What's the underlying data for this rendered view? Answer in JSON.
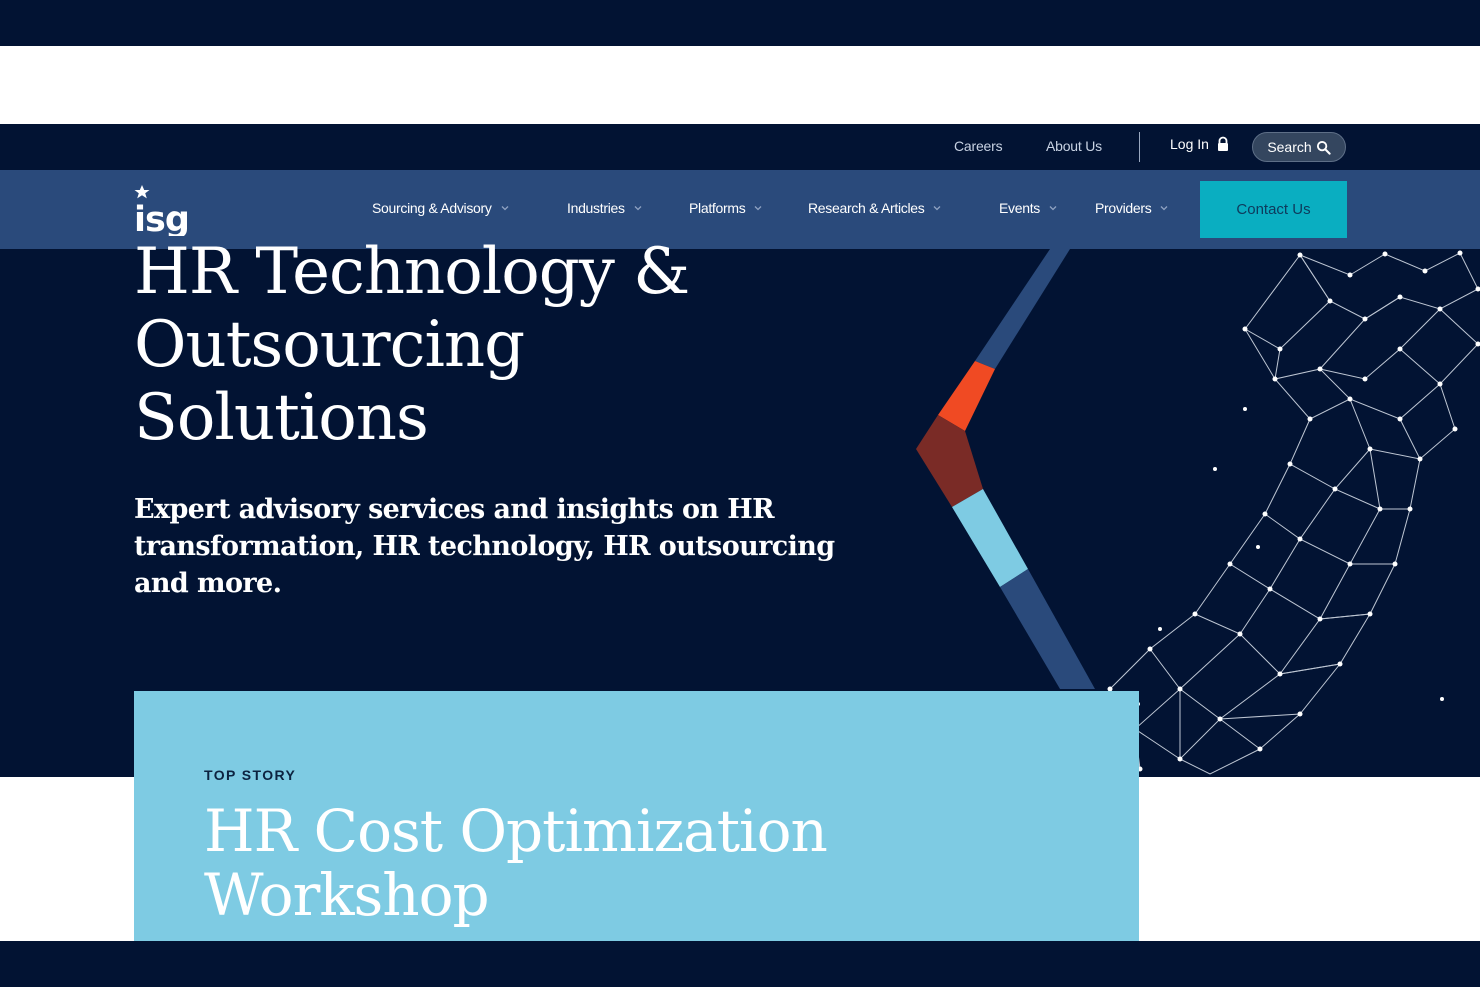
{
  "utility": {
    "careers": "Careers",
    "about": "About Us",
    "login": "Log In",
    "search": "Search"
  },
  "nav": {
    "items": [
      {
        "label": "Sourcing & Advisory"
      },
      {
        "label": "Industries"
      },
      {
        "label": "Platforms"
      },
      {
        "label": "Research & Articles"
      },
      {
        "label": "Events"
      },
      {
        "label": "Providers"
      }
    ],
    "contact": "Contact Us"
  },
  "logo": {
    "text": "isg"
  },
  "hero": {
    "title_lines": [
      "HR Technology &",
      "Outsourcing",
      "Solutions"
    ],
    "subtitle": "Expert advisory services and insights on HR transformation, HR technology, HR outsourcing and more."
  },
  "story": {
    "kicker": "TOP STORY",
    "title_lines": [
      "HR Cost Optimization",
      "Workshop"
    ]
  },
  "colors": {
    "navy": "#021333",
    "nav_blue": "#2a4a7b",
    "teal": "#0aaec1",
    "light_blue": "#7ecbe3",
    "orange": "#f04a23",
    "maroon": "#7a2b26"
  }
}
